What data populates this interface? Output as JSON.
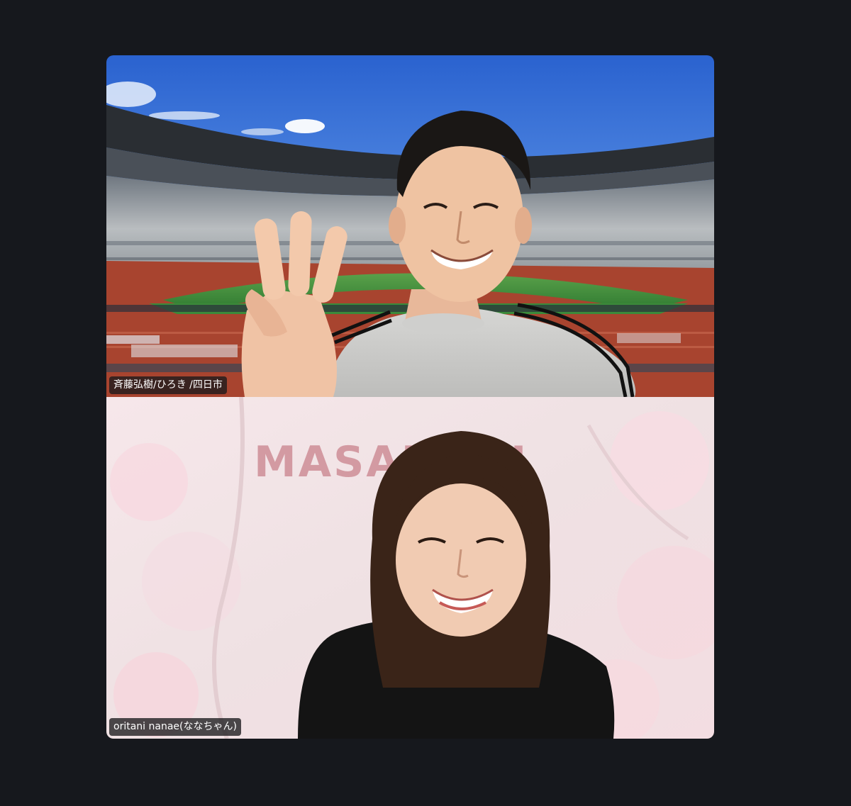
{
  "participants": [
    {
      "name": "斉藤弘樹/ひろき /四日市",
      "background": "stadium",
      "gesture": "three-fingers"
    },
    {
      "name": "oritani nanae(ななちゃん)",
      "background": "cherry-blossom",
      "background_text": "MASAHIRU"
    }
  ],
  "colors": {
    "window_bg": "#16181d",
    "sky": "#2f6fd6",
    "field": "#3f8a3b",
    "track": "#a8442f",
    "blossom": "#f3e3e6",
    "wordmark": "#d39aa2"
  }
}
